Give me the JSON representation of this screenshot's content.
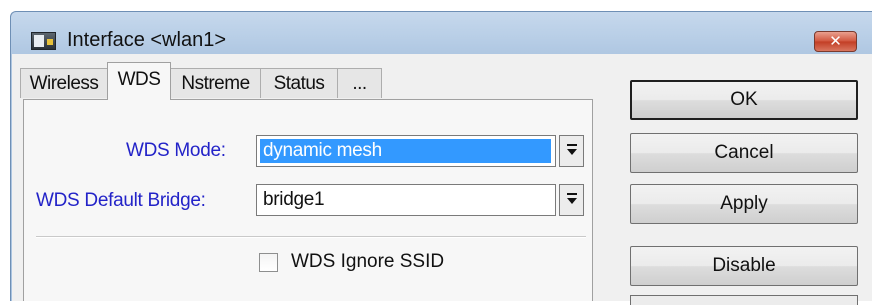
{
  "window": {
    "title": "Interface <wlan1>",
    "close_glyph": "✕",
    "icon": "winbox-window-icon"
  },
  "tabs": [
    {
      "label": "Wireless",
      "active": false
    },
    {
      "label": "WDS",
      "active": true
    },
    {
      "label": "Nstreme",
      "active": false
    },
    {
      "label": "Status",
      "active": false
    },
    {
      "label": "...",
      "active": false
    }
  ],
  "form": {
    "wds_mode_label": "WDS Mode:",
    "wds_mode_value": "dynamic mesh",
    "wds_default_bridge_label": "WDS Default Bridge:",
    "wds_default_bridge_value": "bridge1",
    "wds_ignore_ssid_label": "WDS Ignore SSID",
    "wds_ignore_ssid_checked": false
  },
  "buttons": {
    "ok": "OK",
    "cancel": "Cancel",
    "apply": "Apply",
    "disable": "Disable"
  },
  "colors": {
    "label_blue": "#2323c8",
    "selection": "#3399ff",
    "close_red": "#c23d24"
  }
}
